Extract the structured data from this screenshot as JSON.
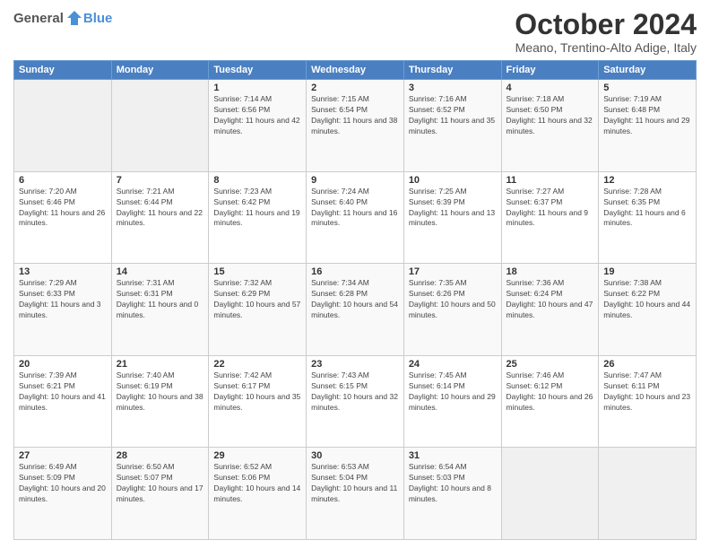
{
  "header": {
    "logo_general": "General",
    "logo_blue": "Blue",
    "month": "October 2024",
    "location": "Meano, Trentino-Alto Adige, Italy"
  },
  "weekdays": [
    "Sunday",
    "Monday",
    "Tuesday",
    "Wednesday",
    "Thursday",
    "Friday",
    "Saturday"
  ],
  "weeks": [
    [
      {
        "day": "",
        "sunrise": "",
        "sunset": "",
        "daylight": ""
      },
      {
        "day": "",
        "sunrise": "",
        "sunset": "",
        "daylight": ""
      },
      {
        "day": "1",
        "sunrise": "Sunrise: 7:14 AM",
        "sunset": "Sunset: 6:56 PM",
        "daylight": "Daylight: 11 hours and 42 minutes."
      },
      {
        "day": "2",
        "sunrise": "Sunrise: 7:15 AM",
        "sunset": "Sunset: 6:54 PM",
        "daylight": "Daylight: 11 hours and 38 minutes."
      },
      {
        "day": "3",
        "sunrise": "Sunrise: 7:16 AM",
        "sunset": "Sunset: 6:52 PM",
        "daylight": "Daylight: 11 hours and 35 minutes."
      },
      {
        "day": "4",
        "sunrise": "Sunrise: 7:18 AM",
        "sunset": "Sunset: 6:50 PM",
        "daylight": "Daylight: 11 hours and 32 minutes."
      },
      {
        "day": "5",
        "sunrise": "Sunrise: 7:19 AM",
        "sunset": "Sunset: 6:48 PM",
        "daylight": "Daylight: 11 hours and 29 minutes."
      }
    ],
    [
      {
        "day": "6",
        "sunrise": "Sunrise: 7:20 AM",
        "sunset": "Sunset: 6:46 PM",
        "daylight": "Daylight: 11 hours and 26 minutes."
      },
      {
        "day": "7",
        "sunrise": "Sunrise: 7:21 AM",
        "sunset": "Sunset: 6:44 PM",
        "daylight": "Daylight: 11 hours and 22 minutes."
      },
      {
        "day": "8",
        "sunrise": "Sunrise: 7:23 AM",
        "sunset": "Sunset: 6:42 PM",
        "daylight": "Daylight: 11 hours and 19 minutes."
      },
      {
        "day": "9",
        "sunrise": "Sunrise: 7:24 AM",
        "sunset": "Sunset: 6:40 PM",
        "daylight": "Daylight: 11 hours and 16 minutes."
      },
      {
        "day": "10",
        "sunrise": "Sunrise: 7:25 AM",
        "sunset": "Sunset: 6:39 PM",
        "daylight": "Daylight: 11 hours and 13 minutes."
      },
      {
        "day": "11",
        "sunrise": "Sunrise: 7:27 AM",
        "sunset": "Sunset: 6:37 PM",
        "daylight": "Daylight: 11 hours and 9 minutes."
      },
      {
        "day": "12",
        "sunrise": "Sunrise: 7:28 AM",
        "sunset": "Sunset: 6:35 PM",
        "daylight": "Daylight: 11 hours and 6 minutes."
      }
    ],
    [
      {
        "day": "13",
        "sunrise": "Sunrise: 7:29 AM",
        "sunset": "Sunset: 6:33 PM",
        "daylight": "Daylight: 11 hours and 3 minutes."
      },
      {
        "day": "14",
        "sunrise": "Sunrise: 7:31 AM",
        "sunset": "Sunset: 6:31 PM",
        "daylight": "Daylight: 11 hours and 0 minutes."
      },
      {
        "day": "15",
        "sunrise": "Sunrise: 7:32 AM",
        "sunset": "Sunset: 6:29 PM",
        "daylight": "Daylight: 10 hours and 57 minutes."
      },
      {
        "day": "16",
        "sunrise": "Sunrise: 7:34 AM",
        "sunset": "Sunset: 6:28 PM",
        "daylight": "Daylight: 10 hours and 54 minutes."
      },
      {
        "day": "17",
        "sunrise": "Sunrise: 7:35 AM",
        "sunset": "Sunset: 6:26 PM",
        "daylight": "Daylight: 10 hours and 50 minutes."
      },
      {
        "day": "18",
        "sunrise": "Sunrise: 7:36 AM",
        "sunset": "Sunset: 6:24 PM",
        "daylight": "Daylight: 10 hours and 47 minutes."
      },
      {
        "day": "19",
        "sunrise": "Sunrise: 7:38 AM",
        "sunset": "Sunset: 6:22 PM",
        "daylight": "Daylight: 10 hours and 44 minutes."
      }
    ],
    [
      {
        "day": "20",
        "sunrise": "Sunrise: 7:39 AM",
        "sunset": "Sunset: 6:21 PM",
        "daylight": "Daylight: 10 hours and 41 minutes."
      },
      {
        "day": "21",
        "sunrise": "Sunrise: 7:40 AM",
        "sunset": "Sunset: 6:19 PM",
        "daylight": "Daylight: 10 hours and 38 minutes."
      },
      {
        "day": "22",
        "sunrise": "Sunrise: 7:42 AM",
        "sunset": "Sunset: 6:17 PM",
        "daylight": "Daylight: 10 hours and 35 minutes."
      },
      {
        "day": "23",
        "sunrise": "Sunrise: 7:43 AM",
        "sunset": "Sunset: 6:15 PM",
        "daylight": "Daylight: 10 hours and 32 minutes."
      },
      {
        "day": "24",
        "sunrise": "Sunrise: 7:45 AM",
        "sunset": "Sunset: 6:14 PM",
        "daylight": "Daylight: 10 hours and 29 minutes."
      },
      {
        "day": "25",
        "sunrise": "Sunrise: 7:46 AM",
        "sunset": "Sunset: 6:12 PM",
        "daylight": "Daylight: 10 hours and 26 minutes."
      },
      {
        "day": "26",
        "sunrise": "Sunrise: 7:47 AM",
        "sunset": "Sunset: 6:11 PM",
        "daylight": "Daylight: 10 hours and 23 minutes."
      }
    ],
    [
      {
        "day": "27",
        "sunrise": "Sunrise: 6:49 AM",
        "sunset": "Sunset: 5:09 PM",
        "daylight": "Daylight: 10 hours and 20 minutes."
      },
      {
        "day": "28",
        "sunrise": "Sunrise: 6:50 AM",
        "sunset": "Sunset: 5:07 PM",
        "daylight": "Daylight: 10 hours and 17 minutes."
      },
      {
        "day": "29",
        "sunrise": "Sunrise: 6:52 AM",
        "sunset": "Sunset: 5:06 PM",
        "daylight": "Daylight: 10 hours and 14 minutes."
      },
      {
        "day": "30",
        "sunrise": "Sunrise: 6:53 AM",
        "sunset": "Sunset: 5:04 PM",
        "daylight": "Daylight: 10 hours and 11 minutes."
      },
      {
        "day": "31",
        "sunrise": "Sunrise: 6:54 AM",
        "sunset": "Sunset: 5:03 PM",
        "daylight": "Daylight: 10 hours and 8 minutes."
      },
      {
        "day": "",
        "sunrise": "",
        "sunset": "",
        "daylight": ""
      },
      {
        "day": "",
        "sunrise": "",
        "sunset": "",
        "daylight": ""
      }
    ]
  ]
}
